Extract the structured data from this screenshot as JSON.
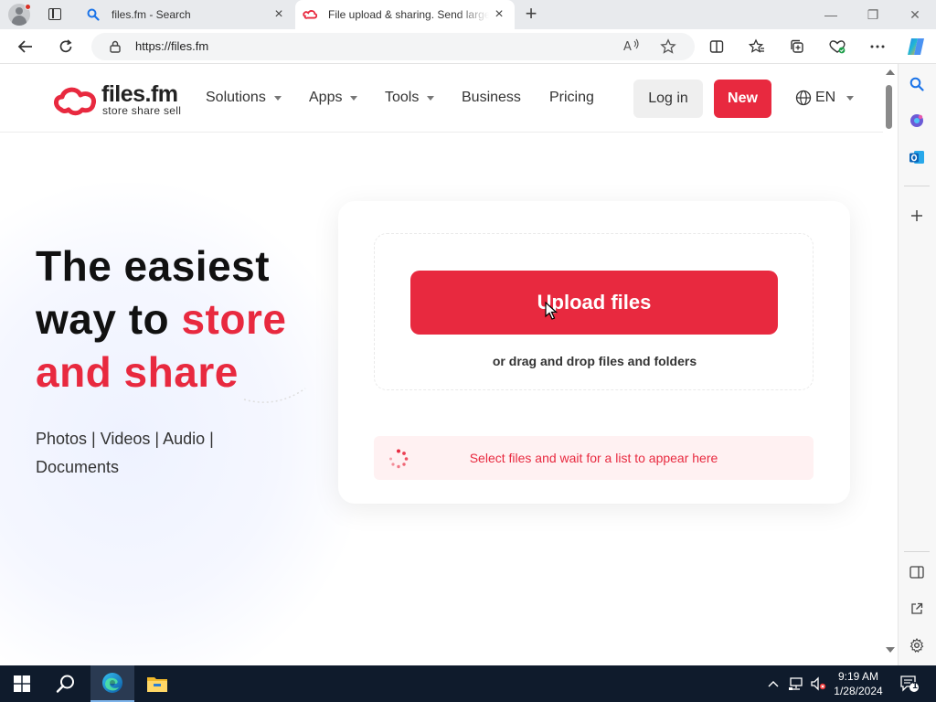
{
  "browser": {
    "tabs": [
      {
        "title": "files.fm - Search",
        "icon": "search-icon"
      },
      {
        "title": "File upload & sharing. Send large files",
        "icon": "files-fm-favicon"
      }
    ],
    "close_glyph": "×",
    "newtab_glyph": "+",
    "window": {
      "minimize": "—",
      "restore": "❐",
      "close": "✕"
    },
    "url": "https://files.fm"
  },
  "nav": {
    "logo_name": "files.fm",
    "logo_tagline": "store  share  sell",
    "items": [
      "Solutions",
      "Apps",
      "Tools",
      "Business",
      "Pricing"
    ],
    "login": "Log in",
    "new": "New",
    "lang": "EN"
  },
  "hero": {
    "line1": "The easiest",
    "line2a": "way to ",
    "line2b": "store",
    "line3": "and share",
    "categories": "Photos | Videos | Audio | Documents"
  },
  "upload": {
    "button": "Upload files",
    "drag_text": "or drag and drop files and folders",
    "status": "Select files and wait for a list to appear here"
  },
  "taskbar": {
    "time": "9:19 AM",
    "date": "1/28/2024",
    "notification_count": "1"
  },
  "colors": {
    "brand": "#e8293f",
    "taskbar": "#0f1b2c"
  }
}
